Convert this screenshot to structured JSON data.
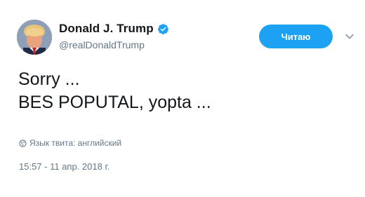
{
  "author": {
    "display_name": "Donald J. Trump",
    "handle": "@realDonaldTrump",
    "verified": true,
    "avatar_icon": "profile-photo"
  },
  "follow_button": {
    "label": "Читаю",
    "color": "#1da1f2"
  },
  "more_menu_icon": "chevron-down-icon",
  "tweet": {
    "lines": [
      "Sorry ...",
      "BES POPUTAL, yopta ..."
    ]
  },
  "translate": {
    "icon": "globe-icon",
    "label": "Язык твита: английский"
  },
  "timestamp": "15:57 - 11 апр. 2018 г.",
  "colors": {
    "primary_text": "#14171a",
    "secondary_text": "#657786",
    "accent": "#1da1f2"
  }
}
